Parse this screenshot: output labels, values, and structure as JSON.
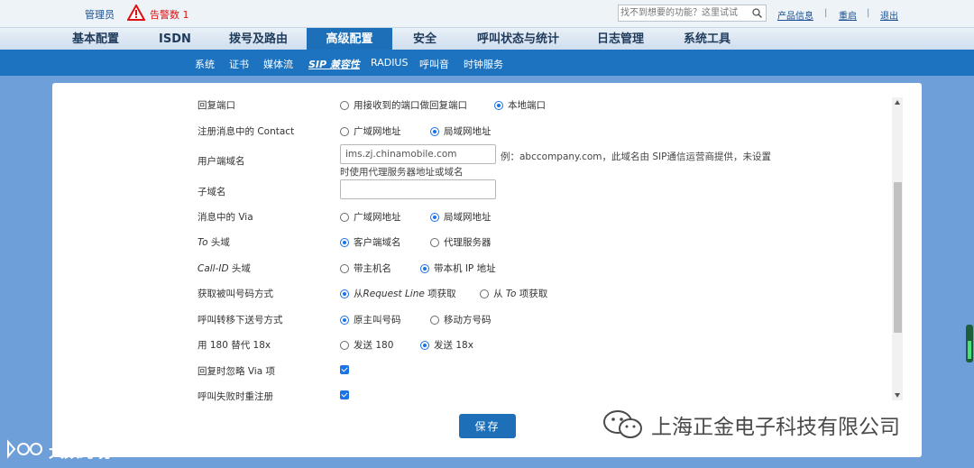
{
  "header": {
    "user": "管理员",
    "alarm_label": "告警数",
    "alarm_count": "1",
    "search_placeholder": "找不到想要的功能？这里试试",
    "links": [
      "产品信息",
      "重启",
      "退出"
    ]
  },
  "main_nav": {
    "items": [
      "基本配置",
      "ISDN",
      "拨号及路由",
      "高级配置",
      "安全",
      "呼叫状态与统计",
      "日志管理",
      "系统工具"
    ],
    "active": "高级配置"
  },
  "sub_nav": {
    "items": [
      "系统",
      "证书",
      "媒体流",
      "SIP 兼容性",
      "RADIUS",
      "呼叫音",
      "时钟服务"
    ],
    "active": "SIP 兼容性"
  },
  "form": {
    "reply_port": {
      "label": "回复端口",
      "options": [
        "用接收到的端口做回复端口",
        "本地端口"
      ],
      "selected": "本地端口"
    },
    "contact": {
      "label": "注册消息中的 Contact",
      "options": [
        "广域网地址",
        "局域网地址"
      ],
      "selected": "局域网地址"
    },
    "user_domain": {
      "label": "用户端域名",
      "value": "ims.zj.chinamobile.com",
      "hint": "例：abccompany.com，此域名由 SIP通信运营商提供，未设置",
      "hint2": "时使用代理服务器地址或域名"
    },
    "subdomain": {
      "label": "子域名",
      "value": ""
    },
    "via": {
      "label": "消息中的 Via",
      "options": [
        "广域网地址",
        "局域网地址"
      ],
      "selected": "局域网地址"
    },
    "to_header": {
      "label_italic": "To",
      "label_rest": " 头域",
      "options": [
        "客户端域名",
        "代理服务器"
      ],
      "selected": "客户端域名"
    },
    "callid_header": {
      "label_italic": "Call-ID",
      "label_rest": " 头域",
      "options": [
        "带主机名",
        "带本机 IP 地址"
      ],
      "selected": "带本机 IP 地址"
    },
    "called_number": {
      "label": "获取被叫号码方式",
      "opt1_pre": "从",
      "opt1_italic": "Request Line",
      "opt1_post": " 项获取",
      "opt2_pre": "从 ",
      "opt2_italic": "To",
      "opt2_post": " 项获取",
      "selected": 0
    },
    "transfer_number": {
      "label": "呼叫转移下送号方式",
      "options": [
        "原主叫号码",
        "移动方号码"
      ],
      "selected": "原主叫号码"
    },
    "replace_180": {
      "label": "用 180 替代 18x",
      "options": [
        "发送 180",
        "发送 18x"
      ],
      "selected": "发送 18x"
    },
    "ignore_via": {
      "label": "回复时忽略 Via 项",
      "checked": true
    },
    "reregister": {
      "label": "呼叫失败时重注册",
      "checked": true
    },
    "save_label": "保存"
  },
  "watermarks": {
    "right": "上海正金电子科技有限公司",
    "left": "大数跨境"
  },
  "colors": {
    "nav_active": "#1d6fb8",
    "subnav_bg": "#1d73c0",
    "page_bg": "#6f9fd9",
    "radio_on": "#1a73e8",
    "alarm": "#dd1111"
  }
}
